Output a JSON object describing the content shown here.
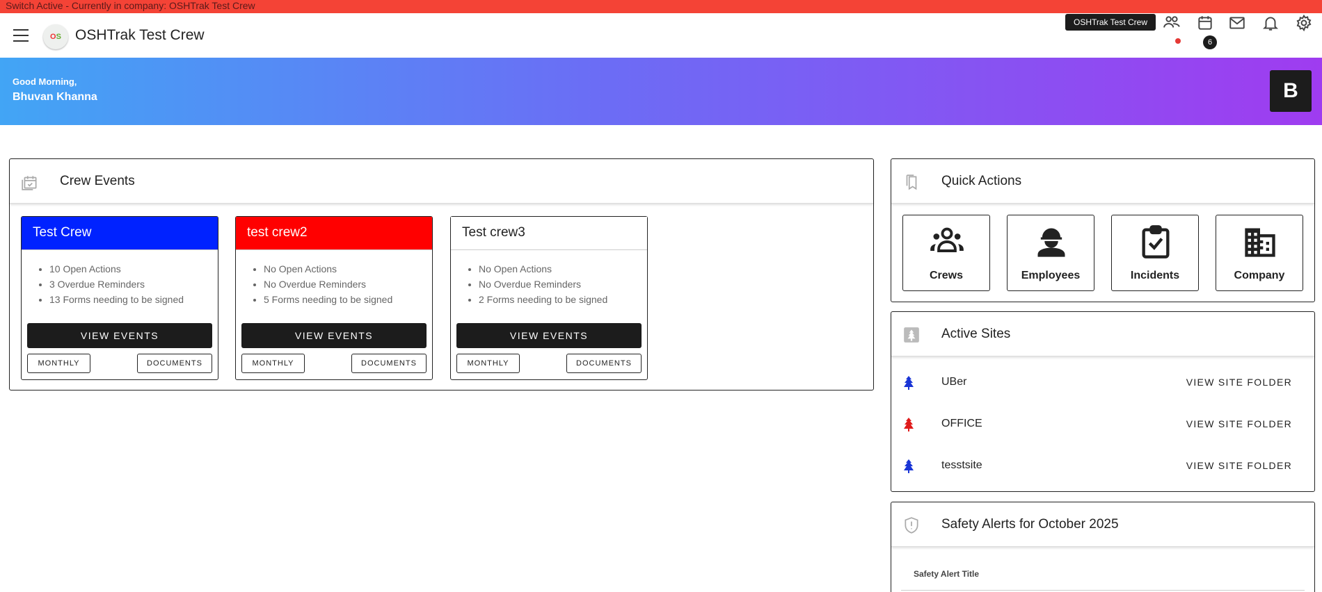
{
  "switch_bar": {
    "text": "Switch Active - Currently in company: OSHTrak Test Crew"
  },
  "app": {
    "title": "OSHTrak Test Crew",
    "logo_text": "OS",
    "company_chip": "OSHTrak Test Crew",
    "calendar_badge": "6"
  },
  "hero": {
    "greeting": "Good Morning,",
    "user_name": "Bhuvan Khanna",
    "avatar_initial": "B"
  },
  "crew_events": {
    "title": "Crew Events",
    "crews": [
      {
        "name": "Test Crew",
        "color": "#0022ff",
        "lines": [
          "10 Open Actions",
          "3 Overdue Reminders",
          "13 Forms needing to be signed"
        ],
        "view_label": "VIEW EVENTS",
        "monthly_label": "MONTHLY",
        "documents_label": "DOCUMENTS"
      },
      {
        "name": "test crew2",
        "color": "#ff0000",
        "lines": [
          "No Open Actions",
          "No Overdue Reminders",
          "5 Forms needing to be signed"
        ],
        "view_label": "VIEW EVENTS",
        "monthly_label": "MONTHLY",
        "documents_label": "DOCUMENTS"
      },
      {
        "name": "Test crew3",
        "color": "#ffffff",
        "lines": [
          "No Open Actions",
          "No Overdue Reminders",
          "2 Forms needing to be signed"
        ],
        "view_label": "VIEW EVENTS",
        "monthly_label": "MONTHLY",
        "documents_label": "DOCUMENTS"
      }
    ]
  },
  "quick_actions": {
    "title": "Quick Actions",
    "items": [
      {
        "label": "Crews",
        "icon": "groups-icon"
      },
      {
        "label": "Employees",
        "icon": "engineer-icon"
      },
      {
        "label": "Incidents",
        "icon": "clipboard-check-icon"
      },
      {
        "label": "Company",
        "icon": "building-icon"
      }
    ]
  },
  "active_sites": {
    "title": "Active Sites",
    "sites": [
      {
        "name": "UBer",
        "tree_color": "#1a35d6",
        "action": "VIEW SITE FOLDER"
      },
      {
        "name": "OFFICE",
        "tree_color": "#e01b1b",
        "action": "VIEW SITE FOLDER"
      },
      {
        "name": "tesstsite",
        "tree_color": "#1a35d6",
        "action": "VIEW SITE FOLDER"
      }
    ]
  },
  "safety_alerts": {
    "title": "Safety Alerts for October 2025",
    "column_title": "Safety Alert Title"
  }
}
